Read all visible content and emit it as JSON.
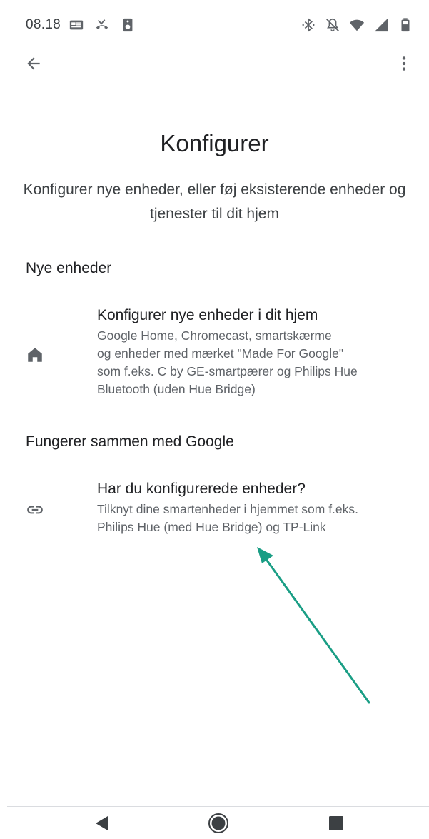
{
  "status_bar": {
    "time": "08.18",
    "left_icons": [
      "news-icon",
      "missed-call-icon",
      "speaker-icon"
    ],
    "right_icons": [
      "bluetooth-icon",
      "mute-icon",
      "wifi-icon",
      "signal-icon",
      "battery-icon"
    ]
  },
  "app_bar": {
    "back_icon": "arrow-back-icon",
    "menu_icon": "more-vert-icon"
  },
  "page": {
    "title": "Konfigurer",
    "subtitle_line1": "Konfigurer nye enheder, eller føj eksisterende enheder og",
    "subtitle_line2": "tjenester til dit hjem"
  },
  "sections": {
    "new_devices": {
      "header": "Nye enheder",
      "item": {
        "icon": "home-icon",
        "title": "Konfigurer nye enheder i dit hjem",
        "desc_lines": [
          "Google Home, Chromecast, smartskærme",
          "og enheder med mærket \"Made For Google\"",
          "som f.eks. C by GE-smartpærer og Philips Hue",
          "Bluetooth (uden Hue Bridge)"
        ]
      }
    },
    "works_with_google": {
      "header": "Fungerer sammen med Google",
      "item": {
        "icon": "link-icon",
        "title": "Har du konfigurerede enheder?",
        "desc_lines": [
          "Tilknyt dine smartenheder i hjemmet som f.eks.",
          "Philips Hue (med Hue Bridge) og TP-Link"
        ]
      }
    }
  },
  "annotation": {
    "color": "#1a9e85",
    "icon": "arrow-annotation"
  },
  "nav_bar": {
    "icons": [
      "nav-back-icon",
      "nav-home-icon",
      "nav-recents-icon"
    ]
  },
  "colors": {
    "background": "#ffffff",
    "primary_text": "#202124",
    "secondary_text": "#5f6368",
    "icon": "#5f6368",
    "divider": "#dadce0"
  }
}
